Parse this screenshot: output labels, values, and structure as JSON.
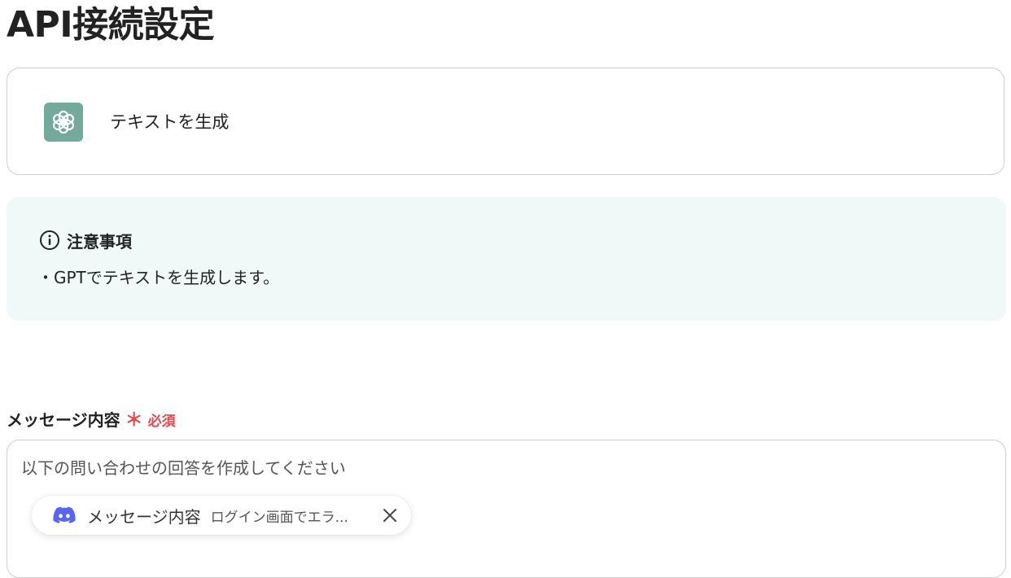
{
  "page": {
    "title": "API接続設定"
  },
  "action_card": {
    "icon": "openai-icon",
    "icon_color": "#74aa9c",
    "label": "テキストを生成"
  },
  "notice": {
    "icon": "info-icon",
    "title": "注意事項",
    "body": "・GPTでテキストを生成します。",
    "background": "#f0f9f8"
  },
  "message_field": {
    "label": "メッセージ内容",
    "required_mark": "＊",
    "required_text": "必須",
    "required_color": "#e5484d",
    "value": "以下の問い合わせの回答を作成してください",
    "variable_chip": {
      "icon": "discord-icon",
      "icon_color": "#5865f2",
      "name": "メッセージ内容",
      "value": "ログイン画面でエラ...",
      "close_icon": "close-icon"
    }
  }
}
